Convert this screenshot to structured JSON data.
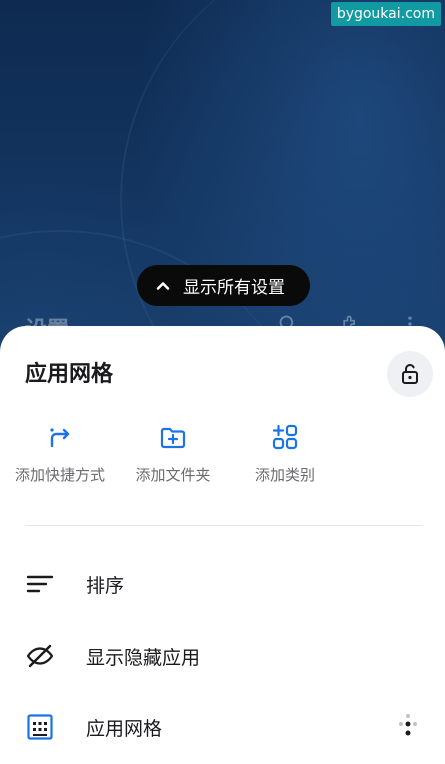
{
  "watermark": "bygoukai.com",
  "pill": {
    "label": "显示所有设置",
    "icon": "chevron-up-icon"
  },
  "background_header": {
    "title": "设置",
    "icons": [
      "search-icon",
      "extension-icon",
      "more-vert-icon"
    ]
  },
  "sheet": {
    "title": "应用网格",
    "lock_icon": "lock-open-icon",
    "actions": [
      {
        "label": "添加快捷方式",
        "icon": "shortcut-icon"
      },
      {
        "label": "添加文件夹",
        "icon": "create-folder-icon"
      },
      {
        "label": "添加类别",
        "icon": "category-add-icon"
      }
    ],
    "items": [
      {
        "label": "排序",
        "icon": "sort-icon"
      },
      {
        "label": "显示隐藏应用",
        "icon": "visibility-off-icon"
      },
      {
        "label": "应用网格",
        "icon": "app-grid-icon",
        "trailing_icon": "drag-handle-icon"
      }
    ]
  },
  "colors": {
    "accent": "#1a73e8",
    "sheet_bg": "#ffffff",
    "text": "#1b1b1f",
    "secondary_text": "#6b6b70"
  }
}
